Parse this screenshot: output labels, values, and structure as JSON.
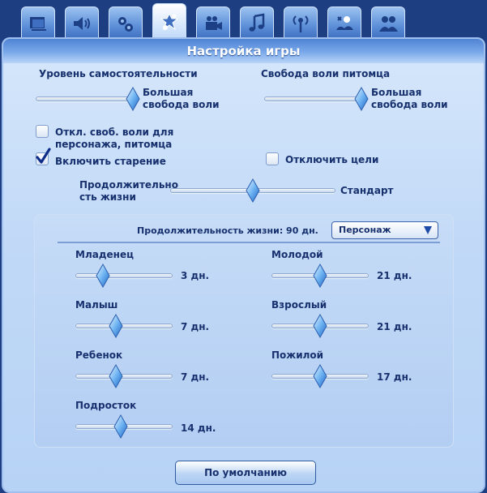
{
  "tabs": [
    {
      "icon": "graphics-settings-icon",
      "active": false
    },
    {
      "icon": "sound-icon",
      "active": false
    },
    {
      "icon": "performance-gears-icon",
      "active": false
    },
    {
      "icon": "game-options-icon",
      "active": true
    },
    {
      "icon": "video-camera-icon",
      "active": false
    },
    {
      "icon": "music-note-icon",
      "active": false
    },
    {
      "icon": "broadcast-icon",
      "active": false
    },
    {
      "icon": "weather-icon",
      "active": false
    },
    {
      "icon": "people-icon",
      "active": false
    }
  ],
  "panel": {
    "title": "Настройка игры"
  },
  "free_will": {
    "sim": {
      "label": "Уровень самостоятельности",
      "value_label": "Большая свобода воли",
      "level": 1.0
    },
    "pet": {
      "label": "Свобода воли питомца",
      "value_label": "Большая свобода воли",
      "level": 1.0
    }
  },
  "checkboxes": {
    "disable_free_will": {
      "label": "Откл. своб. воли для персонажа, питомца",
      "checked": false
    },
    "enable_aging": {
      "label": "Включить старение",
      "checked": true
    },
    "disable_wants": {
      "label": "Отключить цели",
      "checked": false
    }
  },
  "lifespan": {
    "label": "Продолжительно сть жизни",
    "value_label": "Стандарт",
    "level": 0.5
  },
  "lifespan_panel": {
    "total_label": "Продолжительность жизни: 90 дн.",
    "dropdown": {
      "selected": "Персонаж"
    },
    "stages_left": [
      {
        "name": "Младенец",
        "days": "3 дн.",
        "level": 0.28
      },
      {
        "name": "Малыш",
        "days": "7 дн.",
        "level": 0.42
      },
      {
        "name": "Ребенок",
        "days": "7 дн.",
        "level": 0.42
      },
      {
        "name": "Подросток",
        "days": "14 дн.",
        "level": 0.47
      }
    ],
    "stages_right": [
      {
        "name": "Молодой",
        "days": "21 дн.",
        "level": 0.5
      },
      {
        "name": "Взрослый",
        "days": "21 дн.",
        "level": 0.5
      },
      {
        "name": "Пожилой",
        "days": "17 дн.",
        "level": 0.5
      }
    ]
  },
  "buttons": {
    "default_label": "По умолчанию"
  },
  "colors": {
    "text": "#17306e",
    "frame": "#1d3f82",
    "accent": "#4f84d4"
  }
}
